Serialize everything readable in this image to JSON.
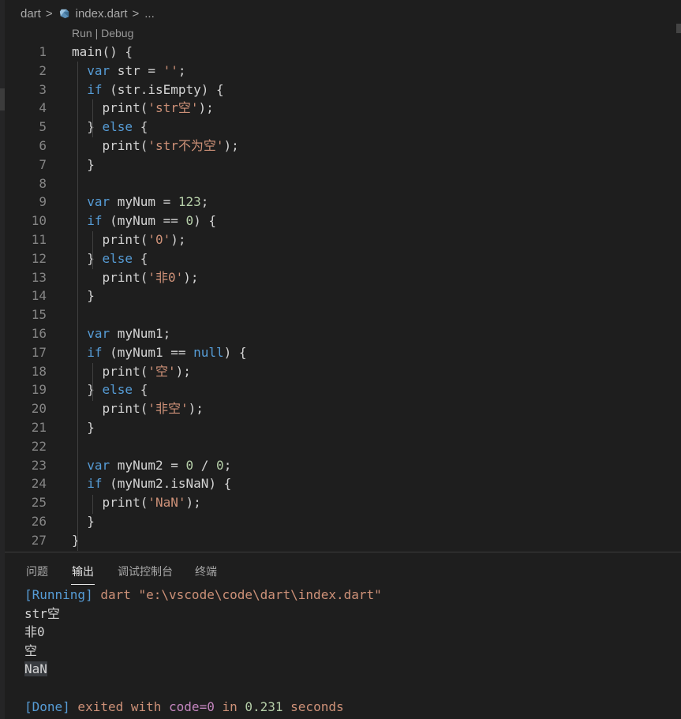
{
  "breadcrumb": {
    "folder": "dart",
    "file": "index.dart",
    "more": "...",
    "sep": ">"
  },
  "codelens": "Run | Debug",
  "code_lines": [
    {
      "n": "1",
      "tokens": [
        [
          "main() {",
          "txt"
        ]
      ]
    },
    {
      "n": "2",
      "tokens": [
        [
          "  ",
          "txt"
        ],
        [
          "var",
          "kw"
        ],
        [
          " str = ",
          "txt"
        ],
        [
          "''",
          "str"
        ],
        [
          ";",
          "txt"
        ]
      ]
    },
    {
      "n": "3",
      "tokens": [
        [
          "  ",
          "txt"
        ],
        [
          "if",
          "kw"
        ],
        [
          " (str.isEmpty) {",
          "txt"
        ]
      ]
    },
    {
      "n": "4",
      "tokens": [
        [
          "    print(",
          "txt"
        ],
        [
          "'str空'",
          "str"
        ],
        [
          ");",
          "txt"
        ]
      ]
    },
    {
      "n": "5",
      "tokens": [
        [
          "  } ",
          "txt"
        ],
        [
          "else",
          "kw"
        ],
        [
          " {",
          "txt"
        ]
      ]
    },
    {
      "n": "6",
      "tokens": [
        [
          "    print(",
          "txt"
        ],
        [
          "'str不为空'",
          "str"
        ],
        [
          ");",
          "txt"
        ]
      ]
    },
    {
      "n": "7",
      "tokens": [
        [
          "  }",
          "txt"
        ]
      ]
    },
    {
      "n": "8",
      "tokens": []
    },
    {
      "n": "9",
      "tokens": [
        [
          "  ",
          "txt"
        ],
        [
          "var",
          "kw"
        ],
        [
          " myNum = ",
          "txt"
        ],
        [
          "123",
          "num"
        ],
        [
          ";",
          "txt"
        ]
      ]
    },
    {
      "n": "10",
      "tokens": [
        [
          "  ",
          "txt"
        ],
        [
          "if",
          "kw"
        ],
        [
          " (myNum == ",
          "txt"
        ],
        [
          "0",
          "num"
        ],
        [
          ") {",
          "txt"
        ]
      ]
    },
    {
      "n": "11",
      "tokens": [
        [
          "    print(",
          "txt"
        ],
        [
          "'0'",
          "str"
        ],
        [
          ");",
          "txt"
        ]
      ]
    },
    {
      "n": "12",
      "tokens": [
        [
          "  } ",
          "txt"
        ],
        [
          "else",
          "kw"
        ],
        [
          " {",
          "txt"
        ]
      ]
    },
    {
      "n": "13",
      "tokens": [
        [
          "    print(",
          "txt"
        ],
        [
          "'非0'",
          "str"
        ],
        [
          ");",
          "txt"
        ]
      ]
    },
    {
      "n": "14",
      "tokens": [
        [
          "  }",
          "txt"
        ]
      ]
    },
    {
      "n": "15",
      "tokens": []
    },
    {
      "n": "16",
      "tokens": [
        [
          "  ",
          "txt"
        ],
        [
          "var",
          "kw"
        ],
        [
          " myNum1;",
          "txt"
        ]
      ]
    },
    {
      "n": "17",
      "tokens": [
        [
          "  ",
          "txt"
        ],
        [
          "if",
          "kw"
        ],
        [
          " (myNum1 == ",
          "txt"
        ],
        [
          "null",
          "kw"
        ],
        [
          ") {",
          "txt"
        ]
      ]
    },
    {
      "n": "18",
      "tokens": [
        [
          "    print(",
          "txt"
        ],
        [
          "'空'",
          "str"
        ],
        [
          ");",
          "txt"
        ]
      ]
    },
    {
      "n": "19",
      "tokens": [
        [
          "  } ",
          "txt"
        ],
        [
          "else",
          "kw"
        ],
        [
          " {",
          "txt"
        ]
      ]
    },
    {
      "n": "20",
      "tokens": [
        [
          "    print(",
          "txt"
        ],
        [
          "'非空'",
          "str"
        ],
        [
          ");",
          "txt"
        ]
      ]
    },
    {
      "n": "21",
      "tokens": [
        [
          "  }",
          "txt"
        ]
      ]
    },
    {
      "n": "22",
      "tokens": []
    },
    {
      "n": "23",
      "tokens": [
        [
          "  ",
          "txt"
        ],
        [
          "var",
          "kw"
        ],
        [
          " myNum2 = ",
          "txt"
        ],
        [
          "0",
          "num"
        ],
        [
          " / ",
          "txt"
        ],
        [
          "0",
          "num"
        ],
        [
          ";",
          "txt"
        ]
      ]
    },
    {
      "n": "24",
      "tokens": [
        [
          "  ",
          "txt"
        ],
        [
          "if",
          "kw"
        ],
        [
          " (myNum2.isNaN) {",
          "txt"
        ]
      ]
    },
    {
      "n": "25",
      "tokens": [
        [
          "    print(",
          "txt"
        ],
        [
          "'NaN'",
          "str"
        ],
        [
          ");",
          "txt"
        ]
      ]
    },
    {
      "n": "26",
      "tokens": [
        [
          "  }",
          "txt"
        ]
      ]
    },
    {
      "n": "27",
      "tokens": [
        [
          "}",
          "txt"
        ]
      ]
    }
  ],
  "panel": {
    "tabs": [
      {
        "label": "问题",
        "active": false
      },
      {
        "label": "输出",
        "active": true
      },
      {
        "label": "调试控制台",
        "active": false
      },
      {
        "label": "终端",
        "active": false
      }
    ]
  },
  "output_lines": [
    [
      [
        "[Running]",
        "o-blue"
      ],
      [
        " dart \"e:\\vscode\\code\\dart\\index.dart\"",
        "o-orange"
      ]
    ],
    [
      [
        "str空",
        "o-plain"
      ]
    ],
    [
      [
        "非0",
        "o-plain"
      ]
    ],
    [
      [
        "空",
        "o-plain"
      ]
    ],
    [
      [
        "NaN",
        "o-plain hl"
      ]
    ],
    [],
    [
      [
        "[Done]",
        "o-blue"
      ],
      [
        " exited with ",
        "o-orange"
      ],
      [
        "code=0",
        "o-purple"
      ],
      [
        " in ",
        "o-orange"
      ],
      [
        "0.231",
        "o-num"
      ],
      [
        " seconds",
        "o-orange"
      ]
    ]
  ],
  "colors": {
    "background": "#1e1e1e",
    "keyword": "#569cd6",
    "string": "#ce9178",
    "number": "#b5cea8",
    "line_number": "#858585",
    "output_purple": "#c586c0"
  },
  "icons": {
    "file": "dart-file-icon"
  }
}
